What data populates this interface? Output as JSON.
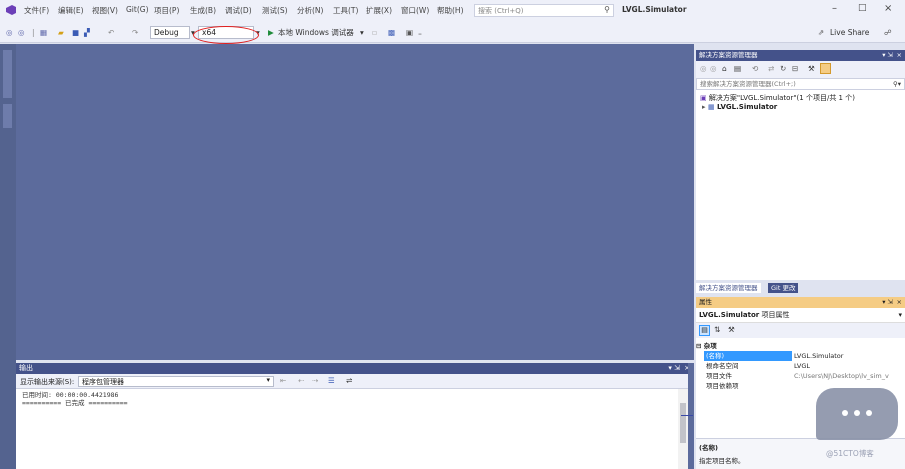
{
  "menu": {
    "items": [
      "文件(F)",
      "编辑(E)",
      "视图(V)",
      "Git(G)",
      "项目(P)",
      "生成(B)",
      "调试(D)",
      "测试(S)",
      "分析(N)",
      "工具(T)",
      "扩展(X)",
      "窗口(W)",
      "帮助(H)"
    ],
    "search_placeholder": "搜索 (Ctrl+Q)",
    "solution_name": "LVGL.Simulator",
    "live_share": "Live Share"
  },
  "toolbar": {
    "config": "Debug",
    "platform": "x64",
    "run_label": "本地 Windows 调试器"
  },
  "output": {
    "title": "输出",
    "source_label": "显示输出来源(S):",
    "source_value": "程序包管理器",
    "lines": [
      "已用时间: 00:00:00.4421986",
      "========== 已完成 =========="
    ]
  },
  "solution_explorer": {
    "title": "解决方案资源管理器",
    "search_placeholder": "搜索解决方案资源管理器(Ctrl+;)",
    "solution_row": "解决方案\"LVGL.Simulator\"(1 个项目/共 1 个)",
    "project_row": "LVGL.Simulator",
    "tabs": [
      "解决方案资源管理器",
      "Git 更改"
    ]
  },
  "properties": {
    "title": "属性",
    "object_name": "LVGL.Simulator",
    "object_type": "项目属性",
    "category": "杂项",
    "rows": [
      {
        "name": "(名称)",
        "value": "LVGL.Simulator"
      },
      {
        "name": "根命名空间",
        "value": "LVGL"
      },
      {
        "name": "项目文件",
        "value": "C:\\Users\\NJ\\Desktop\\lv_sim_v"
      },
      {
        "name": "项目依赖项",
        "value": ""
      }
    ],
    "desc_title": "(名称)",
    "desc_text": "指定项目名称。"
  },
  "watermark": "@51CTO博客",
  "colors": {
    "editor_bg": "#5c6b9c",
    "panel_title": "#44528a",
    "property_title": "#f5cc84",
    "selected_row": "#3399ff",
    "annotation_circle": "#e02020"
  }
}
